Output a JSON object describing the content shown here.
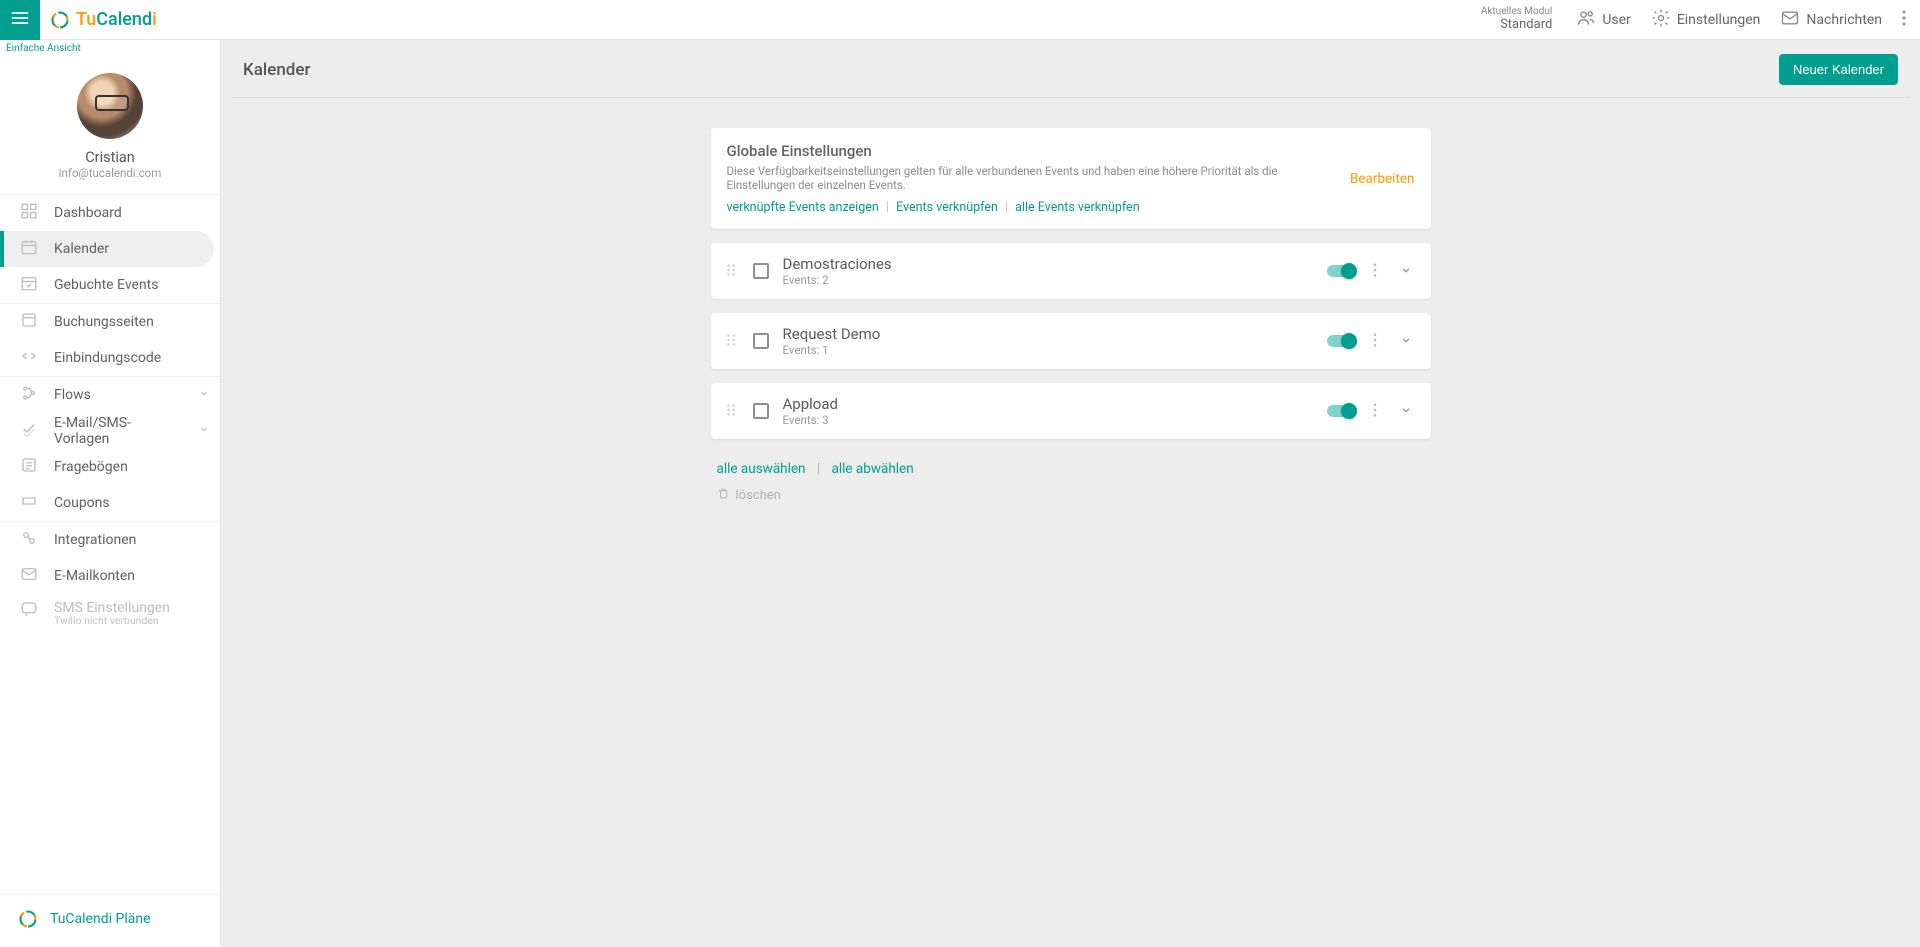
{
  "brand": {
    "tu": "Tu",
    "calend": "Calend",
    "i": "i"
  },
  "header": {
    "module_label": "Aktuelles Modul",
    "module_value": "Standard",
    "user": "User",
    "settings": "Einstellungen",
    "messages": "Nachrichten"
  },
  "sidebar": {
    "easy_view": "Einfache Ansicht",
    "profile": {
      "name": "Cristian",
      "email": "info@tucalendi.com"
    },
    "groups": [
      [
        {
          "label": "Dashboard",
          "icon": "grid"
        },
        {
          "label": "Kalender",
          "icon": "calendar",
          "active": true
        },
        {
          "label": "Gebuchte Events",
          "icon": "check-cal"
        }
      ],
      [
        {
          "label": "Buchungsseiten",
          "icon": "page"
        },
        {
          "label": "Einbindungscode",
          "icon": "code"
        }
      ],
      [
        {
          "label": "Flows",
          "icon": "flow",
          "expandable": true
        },
        {
          "label": "E-Mail/SMS-Vorlagen",
          "icon": "check-badge",
          "expandable": true
        },
        {
          "label": "Fragebögen",
          "icon": "form"
        },
        {
          "label": "Coupons",
          "icon": "ticket"
        }
      ],
      [
        {
          "label": "Integrationen",
          "icon": "integrations"
        },
        {
          "label": "E-Mailkonten",
          "icon": "mail"
        },
        {
          "label": "SMS Einstellungen",
          "icon": "sms",
          "disabled": true,
          "sub": "Twilio nicht verbunden"
        }
      ]
    ],
    "plans": "TuCalendi Pläne"
  },
  "page": {
    "title": "Kalender",
    "new_button": "Neuer Kalender",
    "global": {
      "title": "Globale Einstellungen",
      "desc": "Diese Verfügbarkeitseinstellungen gelten für alle verbundenen Events und haben eine höhere Priorität als die Einstellungen der einzelnen Events.",
      "link_show": "verknüpfte Events anzeigen",
      "link_link": "Events verknüpfen",
      "link_link_all": "alle Events verknüpfen",
      "edit": "Bearbeiten"
    },
    "calendars": [
      {
        "name": "Demostraciones",
        "events_label": "Events: 2"
      },
      {
        "name": "Request Demo",
        "events_label": "Events: 1"
      },
      {
        "name": "Appload",
        "events_label": "Events: 3"
      }
    ],
    "select_all": "alle auswählen",
    "deselect_all": "alle abwählen",
    "delete": "löschen"
  }
}
